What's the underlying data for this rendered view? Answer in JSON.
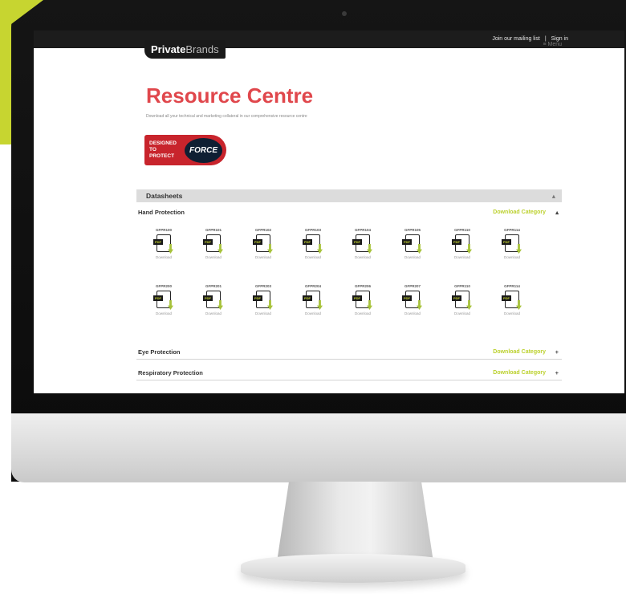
{
  "topbar": {
    "mailing": "Join our mailing list",
    "separator": "|",
    "signin": "Sign in"
  },
  "header": {
    "logo_bold": "Private",
    "logo_light": "Brands",
    "menu": "≡ Menu"
  },
  "page": {
    "title": "Resource Centre",
    "subtitle": "Download all your technical and marketing collateral in our comprehensive resource centre"
  },
  "badge": {
    "line1": "DESIGNED",
    "line2": "TO PROTECT",
    "brand": "FORCE"
  },
  "datasheets": {
    "label": "Datasheets",
    "caret": "▴",
    "categories": [
      {
        "name": "Hand Protection",
        "action": "Download Category",
        "toggle": "▴"
      },
      {
        "name": "Eye Protection",
        "action": "Download Category",
        "toggle": "+"
      },
      {
        "name": "Respiratory Protection",
        "action": "Download Category",
        "toggle": "+"
      }
    ],
    "hand_row1": [
      "GFPR100",
      "GFPR101",
      "GFPR102",
      "GFPR103",
      "GFPR104",
      "GFPR105",
      "GFPR110",
      "GFPR114"
    ],
    "hand_row2": [
      "GFPR200",
      "GFPR201",
      "GFPR203",
      "GFPR204",
      "GFPR206",
      "GFPR207",
      "GFPR110",
      "GFPR114"
    ],
    "file_tag": "PDF",
    "download_label": "Download"
  },
  "colors": {
    "accent": "#c7d530",
    "title_red": "#e0474c",
    "download_green": "#bcd12f"
  }
}
